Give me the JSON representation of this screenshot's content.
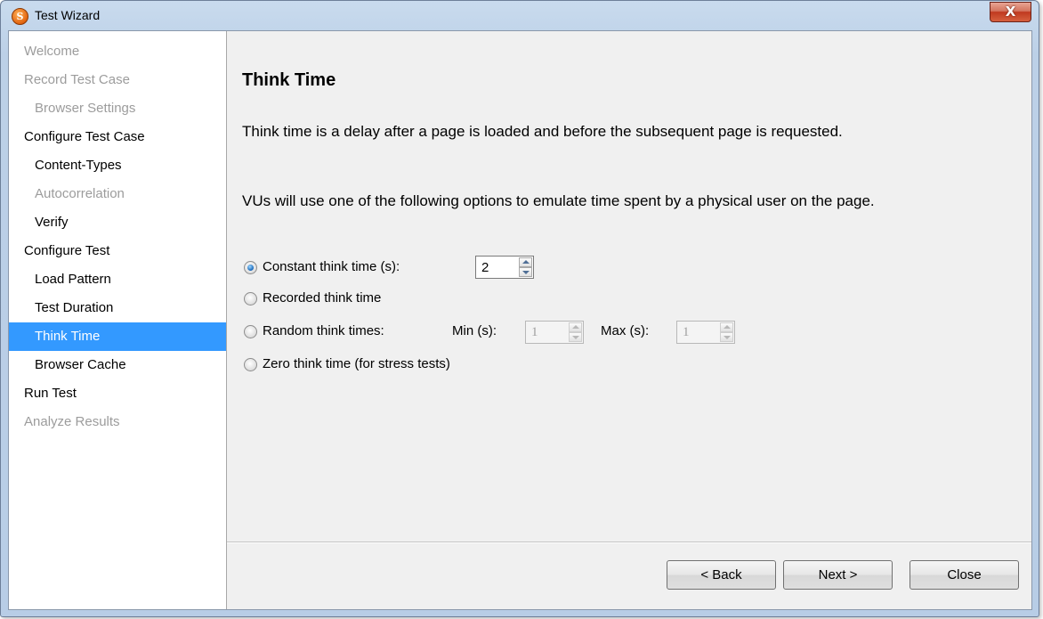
{
  "window": {
    "title": "Test Wizard",
    "close_glyph": "X",
    "app_icon_letter": "S"
  },
  "nav": {
    "items": [
      {
        "label": "Welcome",
        "level": 1,
        "state": "disabled"
      },
      {
        "label": "Record Test Case",
        "level": 1,
        "state": "disabled"
      },
      {
        "label": "Browser Settings",
        "level": 2,
        "state": "disabled"
      },
      {
        "label": "Configure Test Case",
        "level": 1,
        "state": "enabled"
      },
      {
        "label": "Content-Types",
        "level": 2,
        "state": "enabled"
      },
      {
        "label": "Autocorrelation",
        "level": 2,
        "state": "disabled"
      },
      {
        "label": "Verify",
        "level": 2,
        "state": "enabled"
      },
      {
        "label": "Configure Test",
        "level": 1,
        "state": "enabled"
      },
      {
        "label": "Load Pattern",
        "level": 2,
        "state": "enabled"
      },
      {
        "label": "Test Duration",
        "level": 2,
        "state": "enabled"
      },
      {
        "label": "Think Time",
        "level": 2,
        "state": "selected"
      },
      {
        "label": "Browser Cache",
        "level": 2,
        "state": "enabled"
      },
      {
        "label": "Run Test",
        "level": 1,
        "state": "enabled"
      },
      {
        "label": "Analyze Results",
        "level": 1,
        "state": "disabled"
      }
    ]
  },
  "main": {
    "title": "Think Time",
    "description_1": "Think time is a delay after a page is loaded and before the subsequent page is requested.",
    "description_2": "VUs will use one of the following options to emulate time spent by a physical user on the page.",
    "options": {
      "constant": {
        "label": "Constant think time (s):",
        "checked": true,
        "value": "2"
      },
      "recorded": {
        "label": "Recorded think time",
        "checked": false
      },
      "random": {
        "label": "Random think times:",
        "checked": false,
        "min_label": "Min (s):",
        "min_value": "1",
        "max_label": "Max (s):",
        "max_value": "1"
      },
      "zero": {
        "label": "Zero think time (for stress tests)",
        "checked": false
      }
    }
  },
  "footer": {
    "back_label": "< Back",
    "next_label": "Next >",
    "close_label": "Close"
  },
  "colors": {
    "selection": "#3399ff",
    "disabled_text": "#9c9c9c",
    "close_button": "#c0391f"
  }
}
